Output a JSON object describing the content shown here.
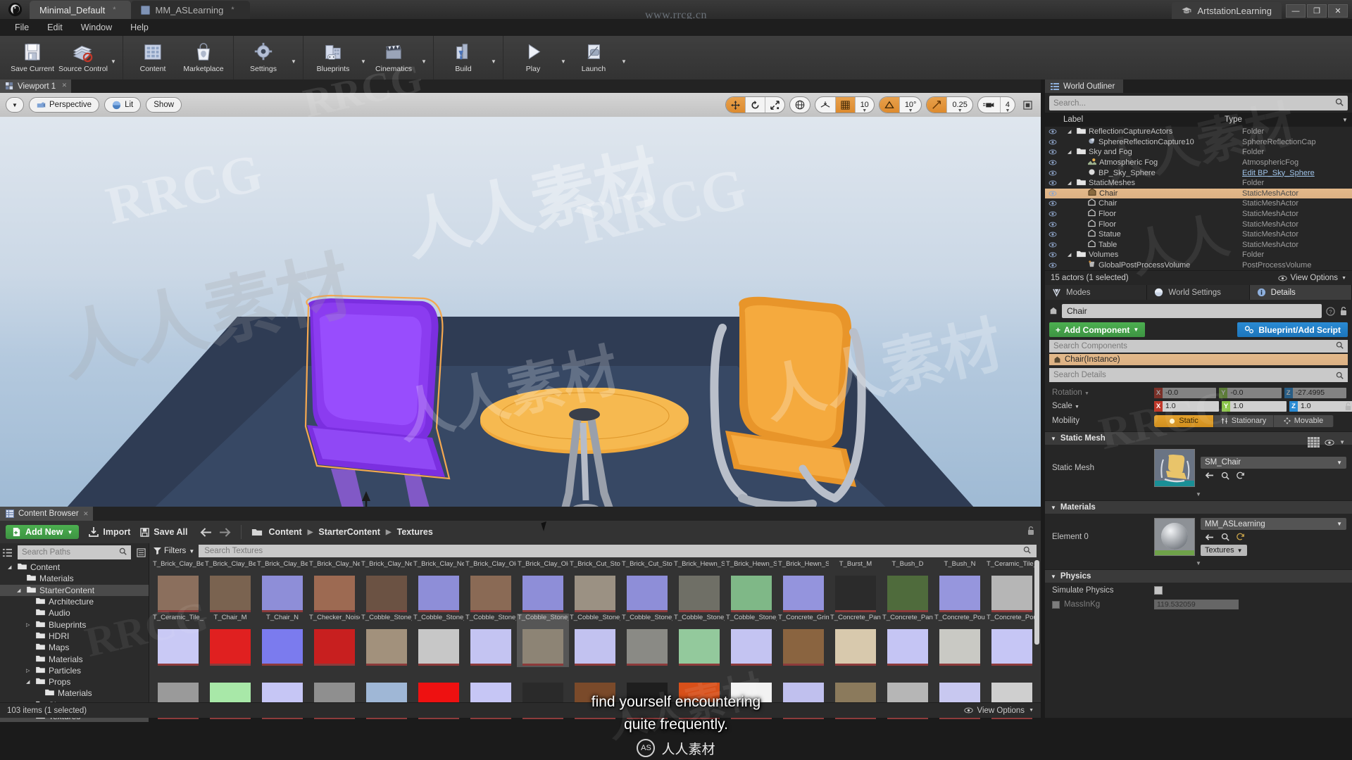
{
  "window": {
    "tabs": [
      {
        "label": "Minimal_Default",
        "modified": "*",
        "icon": "ue-logo-icon"
      },
      {
        "label": "MM_ASLearning",
        "modified": "*",
        "icon": "material-icon"
      }
    ],
    "right_tab": "ArtstationLearning",
    "watermark_center": "www.rrcg.cn",
    "controls": {
      "minimize": "—",
      "maximize": "❐",
      "close": "✕"
    }
  },
  "menu": [
    "File",
    "Edit",
    "Window",
    "Help"
  ],
  "toolbar": {
    "groups": [
      {
        "buttons": [
          {
            "label": "Save Current",
            "icon": "save-icon",
            "caret": false
          },
          {
            "label": "Source Control",
            "icon": "source-control-icon",
            "caret": true
          }
        ]
      },
      {
        "buttons": [
          {
            "label": "Content",
            "icon": "content-icon",
            "caret": false
          },
          {
            "label": "Marketplace",
            "icon": "marketplace-icon",
            "caret": false
          }
        ]
      },
      {
        "buttons": [
          {
            "label": "Settings",
            "icon": "settings-gear-icon",
            "caret": true
          }
        ]
      },
      {
        "buttons": [
          {
            "label": "Blueprints",
            "icon": "blueprints-icon",
            "caret": true
          },
          {
            "label": "Cinematics",
            "icon": "cinematics-clapper-icon",
            "caret": true
          }
        ]
      },
      {
        "buttons": [
          {
            "label": "Build",
            "icon": "build-icon",
            "caret": true
          }
        ]
      },
      {
        "buttons": [
          {
            "label": "Play",
            "icon": "play-icon",
            "caret": true
          },
          {
            "label": "Launch",
            "icon": "launch-icon",
            "caret": true
          }
        ]
      }
    ]
  },
  "viewport": {
    "tab_label": "Viewport 1",
    "left_controls": [
      {
        "label": "Perspective",
        "icon": "camera-icon"
      },
      {
        "label": "Lit",
        "icon": "lighting-sphere-icon"
      },
      {
        "label": "Show",
        "icon": ""
      }
    ],
    "right_controls": {
      "transform_modes": [
        "translate-icon",
        "rotate-icon",
        "scale-icon"
      ],
      "coord_space": "globe-icon",
      "surface_snap": "surface-snap-icon",
      "grid_snap_on": true,
      "grid_size": "10",
      "angle_snap_icon": "angle-icon",
      "angle_size": "10°",
      "scale_snap_icon": "scale-snap-icon",
      "scale_size": "0.25",
      "camera_icon": "camera-speed-icon",
      "camera_speed": "4",
      "maximize_icon": "maximize-viewport-icon"
    }
  },
  "world_outliner": {
    "title": "World Outliner",
    "search_placeholder": "Search...",
    "columns": {
      "label": "Label",
      "type": "Type"
    },
    "rows": [
      {
        "name": "ReflectionCaptureActors",
        "type": "Folder",
        "depth": 1,
        "icon": "folder-icon",
        "expander": true,
        "selected": false
      },
      {
        "name": "SphereReflectionCapture10",
        "type": "SphereReflectionCap",
        "depth": 2,
        "icon": "sphere-reflection-icon",
        "expander": false,
        "selected": false
      },
      {
        "name": "Sky and Fog",
        "type": "Folder",
        "depth": 1,
        "icon": "folder-icon",
        "expander": true,
        "selected": false
      },
      {
        "name": "Atmospheric Fog",
        "type": "AtmosphericFog",
        "depth": 2,
        "icon": "fog-icon",
        "expander": false,
        "selected": false
      },
      {
        "name": "BP_Sky_Sphere",
        "type": "Edit BP_Sky_Sphere",
        "depth": 2,
        "icon": "sphere-icon",
        "expander": false,
        "selected": false,
        "link": true
      },
      {
        "name": "StaticMeshes",
        "type": "Folder",
        "depth": 1,
        "icon": "folder-icon",
        "expander": true,
        "selected": false
      },
      {
        "name": "Chair",
        "type": "StaticMeshActor",
        "depth": 2,
        "icon": "static-mesh-icon",
        "expander": false,
        "selected": true
      },
      {
        "name": "Chair",
        "type": "StaticMeshActor",
        "depth": 2,
        "icon": "static-mesh-icon",
        "expander": false,
        "selected": false
      },
      {
        "name": "Floor",
        "type": "StaticMeshActor",
        "depth": 2,
        "icon": "static-mesh-icon",
        "expander": false,
        "selected": false
      },
      {
        "name": "Floor",
        "type": "StaticMeshActor",
        "depth": 2,
        "icon": "static-mesh-icon",
        "expander": false,
        "selected": false
      },
      {
        "name": "Statue",
        "type": "StaticMeshActor",
        "depth": 2,
        "icon": "static-mesh-icon",
        "expander": false,
        "selected": false
      },
      {
        "name": "Table",
        "type": "StaticMeshActor",
        "depth": 2,
        "icon": "static-mesh-icon",
        "expander": false,
        "selected": false
      },
      {
        "name": "Volumes",
        "type": "Folder",
        "depth": 1,
        "icon": "folder-icon",
        "expander": true,
        "selected": false
      },
      {
        "name": "GlobalPostProcessVolume",
        "type": "PostProcessVolume",
        "depth": 2,
        "icon": "volume-icon",
        "expander": false,
        "selected": false
      }
    ],
    "status": "15 actors (1 selected)",
    "view_options": "View Options"
  },
  "details": {
    "tabs": [
      {
        "label": "Modes",
        "icon": "modes-icon",
        "active": false
      },
      {
        "label": "World Settings",
        "icon": "world-settings-icon",
        "active": false
      },
      {
        "label": "Details",
        "icon": "details-info-icon",
        "active": true
      }
    ],
    "actor_name": "Chair",
    "add_component": "Add Component",
    "blueprint_button": "Blueprint/Add Script",
    "components_placeholder": "Search Components",
    "component_instance": "Chair(Instance)",
    "details_placeholder": "Search Details",
    "transform": {
      "rotation_label": "Rotation",
      "rotation": {
        "x": "-0.0",
        "y": "-0.0",
        "z": "-27.4995"
      },
      "scale_label": "Scale",
      "scale": {
        "x": "1.0",
        "y": "1.0",
        "z": "1.0"
      },
      "mobility_label": "Mobility",
      "mobility_options": [
        "Static",
        "Stationary",
        "Movable"
      ],
      "mobility_selected": "Static"
    },
    "sections": {
      "static_mesh": {
        "header": "Static Mesh",
        "row_label": "Static Mesh",
        "value": "SM_Chair"
      },
      "materials": {
        "header": "Materials",
        "row_label": "Element 0",
        "value": "MM_ASLearning",
        "tag_button": "Textures"
      },
      "physics": {
        "header": "Physics",
        "rows": [
          {
            "label": "Simulate Physics",
            "value": ""
          },
          {
            "label": "MassInKg",
            "value": "119.532059"
          }
        ]
      }
    }
  },
  "content_browser": {
    "tab_label": "Content Browser",
    "toolbar": {
      "add_new": "Add New",
      "import": "Import",
      "save_all": "Save All",
      "back_icon": "back-arrow-icon",
      "forward_icon": "forward-arrow-icon",
      "breadcrumb": [
        "Content",
        "StarterContent",
        "Textures"
      ]
    },
    "paths_placeholder": "Search Paths",
    "filters_label": "Filters",
    "search_placeholder": "Search Textures",
    "tree": [
      {
        "label": "Content",
        "depth": 0,
        "expander": "open",
        "selected": false
      },
      {
        "label": "Materials",
        "depth": 1,
        "expander": "none",
        "selected": false
      },
      {
        "label": "StarterContent",
        "depth": 1,
        "expander": "open",
        "selected": true
      },
      {
        "label": "Architecture",
        "depth": 2,
        "expander": "none",
        "selected": false
      },
      {
        "label": "Audio",
        "depth": 2,
        "expander": "none",
        "selected": false
      },
      {
        "label": "Blueprints",
        "depth": 2,
        "expander": "closed",
        "selected": false
      },
      {
        "label": "HDRI",
        "depth": 2,
        "expander": "none",
        "selected": false
      },
      {
        "label": "Maps",
        "depth": 2,
        "expander": "none",
        "selected": false
      },
      {
        "label": "Materials",
        "depth": 2,
        "expander": "none",
        "selected": false
      },
      {
        "label": "Particles",
        "depth": 2,
        "expander": "closed",
        "selected": false
      },
      {
        "label": "Props",
        "depth": 2,
        "expander": "open",
        "selected": false
      },
      {
        "label": "Materials",
        "depth": 3,
        "expander": "none",
        "selected": false
      },
      {
        "label": "Shapes",
        "depth": 2,
        "expander": "none",
        "selected": false
      },
      {
        "label": "Textures",
        "depth": 2,
        "expander": "none",
        "selected": true
      }
    ],
    "assets_row1": [
      {
        "name": "T_Brick_Clay_Beveled_D",
        "color": "#8b6f5d"
      },
      {
        "name": "T_Brick_Clay_Beveled_M",
        "color": "#7a6350"
      },
      {
        "name": "T_Brick_Clay_Beveled_N",
        "color": "#8e8ed8"
      },
      {
        "name": "T_Brick_Clay_New_D",
        "color": "#9d6a52"
      },
      {
        "name": "T_Brick_Clay_New_M",
        "color": "#6b5243"
      },
      {
        "name": "T_Brick_Clay_New_N",
        "color": "#8e8ed8"
      },
      {
        "name": "T_Brick_Clay_Old_D",
        "color": "#8a6a55"
      },
      {
        "name": "T_Brick_Clay_Old_N",
        "color": "#8e8ed8"
      },
      {
        "name": "T_Brick_Cut_Stone_D",
        "color": "#9b9183"
      },
      {
        "name": "T_Brick_Cut_Stone_N",
        "color": "#8e8ed8"
      },
      {
        "name": "T_Brick_Hewn_Stone_D",
        "color": "#6f6f66"
      },
      {
        "name": "T_Brick_Hewn_Stone_M",
        "color": "#7fb887"
      },
      {
        "name": "T_Brick_Hewn_Stone_N",
        "color": "#9494dd"
      },
      {
        "name": "T_Burst_M",
        "color": "#2b2b2b"
      },
      {
        "name": "T_Bush_D",
        "color": "#4f6b3c"
      },
      {
        "name": "T_Bush_N",
        "color": "#9696dd"
      },
      {
        "name": "T_Ceramic_Tile_M",
        "color": "#b6b6b6"
      }
    ],
    "assets_row2": [
      {
        "name": "T_Ceramic_Tile_N",
        "color": "#c9c9f5"
      },
      {
        "name": "T_Chair_M",
        "color": "#e02020"
      },
      {
        "name": "T_Chair_N",
        "color": "#7b7bee"
      },
      {
        "name": "T_Checker_Noise_M",
        "color": "#c81f1f"
      },
      {
        "name": "T_Cobble_Stone_Pebble_D",
        "color": "#a2917c"
      },
      {
        "name": "T_Cobble_Stone_Pebble_M",
        "color": "#c7c7c7"
      },
      {
        "name": "T_Cobble_Stone_Pebble_N",
        "color": "#c4c4f2"
      },
      {
        "name": "T_Cobble_Stone_Rough_D",
        "color": "#8d8475",
        "selected": true
      },
      {
        "name": "T_Cobble_Stone_Rough_N",
        "color": "#c2c2f0"
      },
      {
        "name": "T_Cobble_Stone_Smooth_D",
        "color": "#8a8a85"
      },
      {
        "name": "T_Cobble_Stone_Smooth_M",
        "color": "#93c99c"
      },
      {
        "name": "T_Cobble_Stone_Smooth_N",
        "color": "#c4c4f2"
      },
      {
        "name": "T_Concrete_Grime_D",
        "color": "#8a6440"
      },
      {
        "name": "T_Concrete_Panels_D",
        "color": "#d8c9ad"
      },
      {
        "name": "T_Concrete_Panels_N",
        "color": "#c5c5f4"
      },
      {
        "name": "T_Concrete_Poured_D",
        "color": "#c9c9c4"
      },
      {
        "name": "T_Concrete_Poured_N",
        "color": "#c6c6f5"
      }
    ],
    "assets_row3": [
      {
        "name": "",
        "color": "#9a9a9a"
      },
      {
        "name": "",
        "color": "#a8e8a8"
      },
      {
        "name": "",
        "color": "#c6c6f5"
      },
      {
        "name": "",
        "color": "#8f8f8f"
      },
      {
        "name": "",
        "color": "#9fb7d6"
      },
      {
        "name": "",
        "color": "#ee1111"
      },
      {
        "name": "",
        "color": "#c6c6f5"
      },
      {
        "name": "",
        "color": "#2a2a2a"
      },
      {
        "name": "",
        "color": "#7a4a2a"
      },
      {
        "name": "",
        "color": "#1e1e1e"
      },
      {
        "name": "",
        "color": "#d8501a"
      },
      {
        "name": "",
        "color": "#f2f2f2"
      },
      {
        "name": "",
        "color": "#c0c0ee"
      },
      {
        "name": "",
        "color": "#8b7a5c"
      },
      {
        "name": "",
        "color": "#b6b6b6"
      },
      {
        "name": "",
        "color": "#c8c8f0"
      },
      {
        "name": "",
        "color": "#cfcfcf"
      }
    ],
    "status": "103 items (1 selected)",
    "view_options": "View Options"
  },
  "subtitle": {
    "line1": "find yourself encountering",
    "line2": "quite frequently."
  },
  "brand": {
    "logo": "AS",
    "text": "人人素材"
  },
  "colors": {
    "accent_orange": "#dd8b2e",
    "selection": "#dcb184",
    "green": "#4caf50",
    "blue": "#2a8bd4",
    "panel_bg": "#262626"
  }
}
